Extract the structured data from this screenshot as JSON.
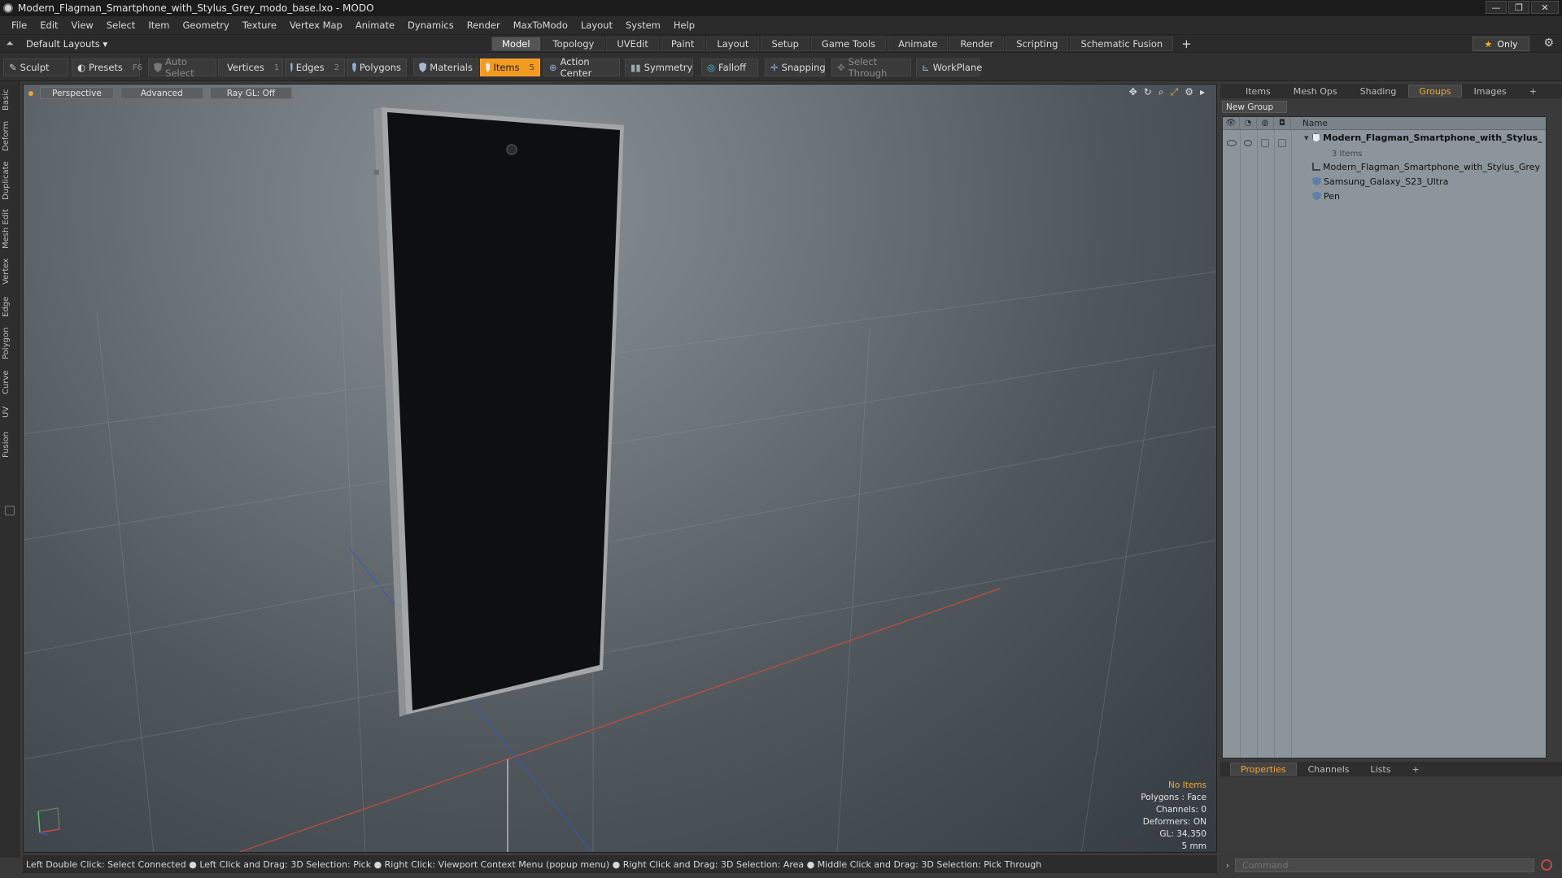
{
  "window": {
    "title": "Modern_Flagman_Smartphone_with_Stylus_Grey_modo_base.lxo - MODO",
    "controls": [
      "—",
      "❐",
      "✕"
    ]
  },
  "menu": [
    "File",
    "Edit",
    "View",
    "Select",
    "Item",
    "Geometry",
    "Texture",
    "Vertex Map",
    "Animate",
    "Dynamics",
    "Render",
    "MaxToModo",
    "Layout",
    "System",
    "Help"
  ],
  "layout_row": {
    "layouts_label": "Default Layouts ▾",
    "tabs": [
      "Model",
      "Topology",
      "UVEdit",
      "Paint",
      "Layout",
      "Setup",
      "Game Tools",
      "Animate",
      "Render",
      "Scripting",
      "Schematic Fusion"
    ],
    "active_tab": "Model",
    "plus": "+",
    "only_label": "Only"
  },
  "toolbar": {
    "sculpt": "Sculpt",
    "presets": "Presets",
    "presets_key": "F6",
    "auto_select": "Auto Select",
    "vertices": "Vertices",
    "vertices_key": "1",
    "edges": "Edges",
    "edges_key": "2",
    "polygons": "Polygons",
    "materials": "Materials",
    "items": "Items",
    "items_key": "5",
    "action_center": "Action Center",
    "symmetry": "Symmetry",
    "falloff": "Falloff",
    "snapping": "Snapping",
    "select_through": "Select Through",
    "workplane": "WorkPlane"
  },
  "left_tabs": [
    "Basic",
    "Deform",
    "Duplicate",
    "Mesh Edit",
    "Vertex",
    "Edge",
    "Polygon",
    "Curve",
    "UV",
    "Fusion"
  ],
  "viewport": {
    "view_mode": "Perspective",
    "advanced": "Advanced",
    "ray_gl": "Ray GL: Off",
    "info": {
      "no_items": "No Items",
      "polygons": "Polygons : Face",
      "channels": "Channels: 0",
      "deformers": "Deformers: ON",
      "gl": "GL: 34,350",
      "scale": "5 mm"
    }
  },
  "statusbar": {
    "text": "Left Double Click: Select Connected ● Left Click and Drag: 3D Selection: Pick ● Right Click: Viewport Context Menu (popup menu) ● Right Click and Drag: 3D Selection: Area ● Middle Click and Drag: 3D Selection: Pick Through"
  },
  "right_panel": {
    "tabs": [
      "Items",
      "Mesh Ops",
      "Shading",
      "Groups",
      "Images"
    ],
    "active_tab": "Groups",
    "plus": "+",
    "new_group": "New Group",
    "name_header": "Name",
    "group": {
      "name": "Modern_Flagman_Smartphone_with_Stylus_ ...",
      "count": "3 Items",
      "items": [
        "Modern_Flagman_Smartphone_with_Stylus_Grey",
        "Samsung_Galaxy_S23_Ultra",
        "Pen"
      ]
    },
    "bottom_tabs": [
      "Properties",
      "Channels",
      "Lists"
    ],
    "bottom_active": "Properties",
    "command_placeholder": "Command"
  },
  "colors": {
    "accent": "#f39a20",
    "active_tab_text": "#f3a532"
  }
}
